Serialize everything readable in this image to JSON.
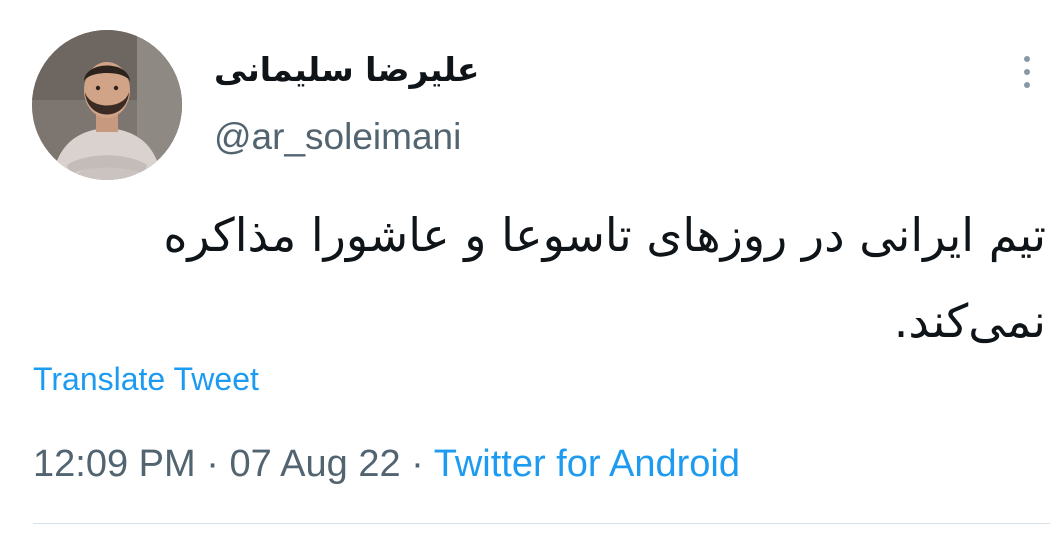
{
  "author": {
    "display_name": "علیرضا سلیمانی",
    "handle": "@ar_soleimani"
  },
  "more_icon": "more-vertical-icon",
  "tweet": {
    "text_line1": "تیم ایرانی در روزهای تاسوعا و عاشورا مذاکره",
    "text_line2": "نمی‌کند."
  },
  "actions": {
    "translate_label": "Translate Tweet"
  },
  "meta": {
    "time": "12:09 PM",
    "separator": " · ",
    "date": "07 Aug 22",
    "source": "Twitter for Android"
  },
  "colors": {
    "link": "#1d9bf0",
    "secondary_text": "#536471",
    "primary_text": "#0f1419"
  }
}
